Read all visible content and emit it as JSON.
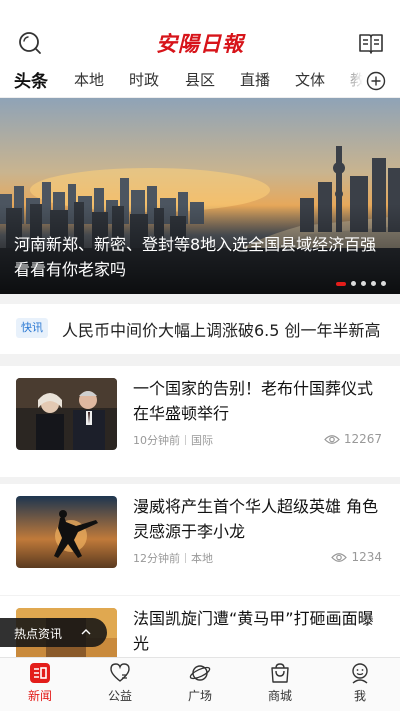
{
  "header": {
    "logo_text": "安陽日報",
    "search_icon": "search-icon",
    "menu_icon": "book-icon"
  },
  "tabs": [
    {
      "label": "头条",
      "active": true
    },
    {
      "label": "本地"
    },
    {
      "label": "时政"
    },
    {
      "label": "县区"
    },
    {
      "label": "直播"
    },
    {
      "label": "文体"
    },
    {
      "label": "教"
    }
  ],
  "banner": {
    "title": "河南新郑、新密、登封等8地入选全国县域经济百强 看看有你老家吗",
    "slide_count": 5,
    "active_slide": 1
  },
  "flash": {
    "badge": "快讯",
    "text": "人民币中间价大幅上调涨破6.5 创一年半新高"
  },
  "news": [
    {
      "title": "一个国家的告别！老布什国葬仪式在华盛顿举行",
      "time": "10分钟前",
      "category": "国际",
      "views": "12267"
    },
    {
      "title": "漫威将产生首个华人超级英雄 角色灵感源于李小龙",
      "time": "12分钟前",
      "category": "本地",
      "views": "1234"
    },
    {
      "title": "法国凯旋门遭“黄马甲”打砸画面曝光"
    }
  ],
  "hot_news": {
    "label": "热点资讯"
  },
  "bottom_nav": [
    {
      "label": "新闻",
      "icon": "news-icon",
      "active": true
    },
    {
      "label": "公益",
      "icon": "heart-icon"
    },
    {
      "label": "广场",
      "icon": "planet-icon"
    },
    {
      "label": "商城",
      "icon": "shopping-bag-icon"
    },
    {
      "label": "我",
      "icon": "user-icon"
    }
  ],
  "colors": {
    "brand_red": "#e31d1a",
    "flash_blue": "#2a78d2"
  }
}
